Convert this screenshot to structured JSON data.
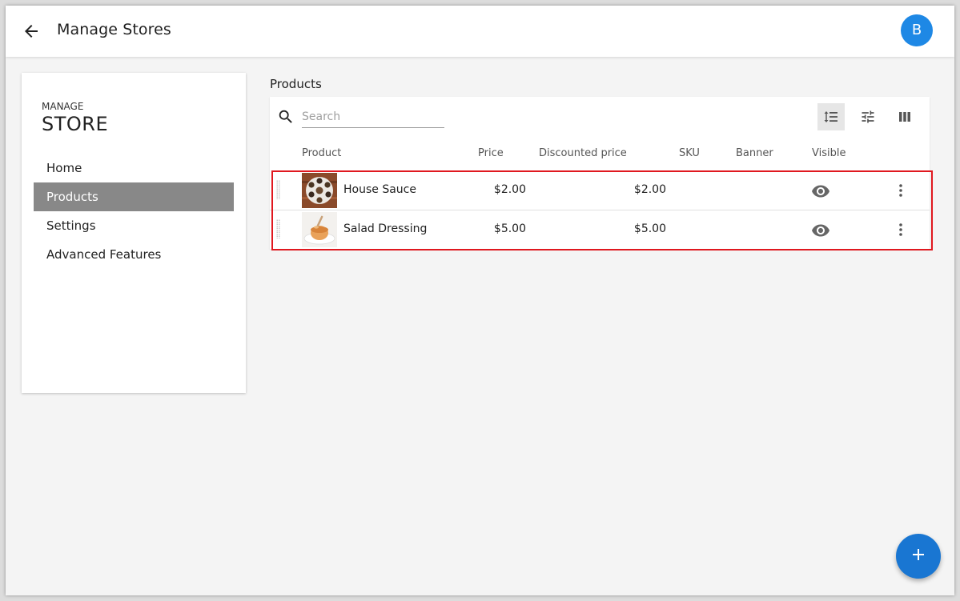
{
  "colors": {
    "accent": "#1976d2",
    "avatar_bg": "#1e88e5",
    "active_nav_bg": "#888888",
    "highlight_border": "#e0181f"
  },
  "header": {
    "title": "Manage Stores",
    "back_icon": "arrow-back-icon",
    "avatar_letter": "B"
  },
  "sidebar": {
    "subtitle": "MANAGE",
    "title": "STORE",
    "items": [
      {
        "label": "Home",
        "active": false
      },
      {
        "label": "Products",
        "active": true
      },
      {
        "label": "Settings",
        "active": false
      },
      {
        "label": "Advanced Features",
        "active": false
      }
    ]
  },
  "main": {
    "section_title": "Products",
    "search": {
      "placeholder": "Search",
      "value": "",
      "icon": "search-icon"
    },
    "toolbar": [
      {
        "icon": "density-icon",
        "active": true
      },
      {
        "icon": "filter-sliders-icon",
        "active": false
      },
      {
        "icon": "columns-icon",
        "active": false
      }
    ],
    "columns": [
      "Product",
      "Price",
      "Discounted price",
      "SKU",
      "Banner",
      "Visible"
    ],
    "rows": [
      {
        "name": "House Sauce",
        "price": "$2.00",
        "discounted_price": "$2.00",
        "sku": "",
        "banner": "",
        "visible": true,
        "thumb_icon": "sauce-platter-image"
      },
      {
        "name": "Salad Dressing",
        "price": "$5.00",
        "discounted_price": "$5.00",
        "sku": "",
        "banner": "",
        "visible": true,
        "thumb_icon": "dressing-bowl-image"
      }
    ]
  },
  "fab": {
    "icon": "plus-icon"
  }
}
